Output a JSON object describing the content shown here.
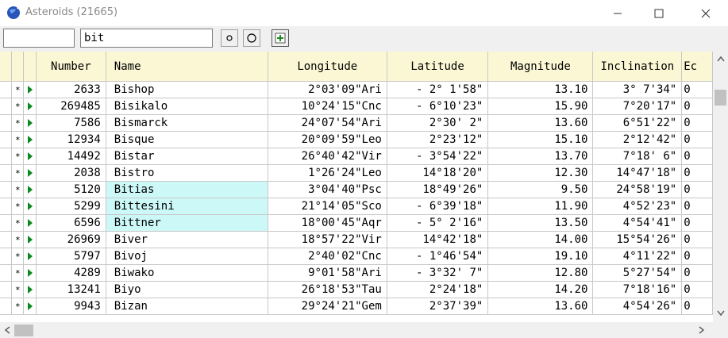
{
  "window": {
    "title": "Asteroids (21665)",
    "icon": "globe-icon"
  },
  "toolbar": {
    "field1_value": "",
    "search_value": "bit",
    "btn1_icon": "radio-small-icon",
    "btn2_icon": "radio-icon",
    "btn3_icon": "add-column-icon"
  },
  "columns": [
    "Number",
    "Name",
    "Longitude",
    "Latitude",
    "Magnitude",
    "Inclination",
    "Ec"
  ],
  "rows": [
    {
      "mark": "*",
      "number": "2633",
      "name": "Bishop",
      "longitude": "2°03'09\"Ari",
      "latitude": "- 2° 1'58\"",
      "magnitude": "13.10",
      "inclination": "3° 7'34\"",
      "ec": "0",
      "hl": false
    },
    {
      "mark": "*",
      "number": "269485",
      "name": "Bisikalo",
      "longitude": "10°24'15\"Cnc",
      "latitude": "- 6°10'23\"",
      "magnitude": "15.90",
      "inclination": "7°20'17\"",
      "ec": "0",
      "hl": false
    },
    {
      "mark": "*",
      "number": "7586",
      "name": "Bismarck",
      "longitude": "24°07'54\"Ari",
      "latitude": "2°30' 2\"",
      "magnitude": "13.60",
      "inclination": "6°51'22\"",
      "ec": "0",
      "hl": false
    },
    {
      "mark": "*",
      "number": "12934",
      "name": "Bisque",
      "longitude": "20°09'59\"Leo",
      "latitude": "2°23'12\"",
      "magnitude": "15.10",
      "inclination": "2°12'42\"",
      "ec": "0",
      "hl": false
    },
    {
      "mark": "*",
      "number": "14492",
      "name": "Bistar",
      "longitude": "26°40'42\"Vir",
      "latitude": "- 3°54'22\"",
      "magnitude": "13.70",
      "inclination": "7°18' 6\"",
      "ec": "0",
      "hl": false
    },
    {
      "mark": "*",
      "number": "2038",
      "name": "Bistro",
      "longitude": "1°26'24\"Leo",
      "latitude": "14°18'20\"",
      "magnitude": "12.30",
      "inclination": "14°47'18\"",
      "ec": "0",
      "hl": false
    },
    {
      "mark": "*",
      "number": "5120",
      "name": "Bitias",
      "longitude": "3°04'40\"Psc",
      "latitude": "18°49'26\"",
      "magnitude": "9.50",
      "inclination": "24°58'19\"",
      "ec": "0",
      "hl": true
    },
    {
      "mark": "*",
      "number": "5299",
      "name": "Bittesini",
      "longitude": "21°14'05\"Sco",
      "latitude": "- 6°39'18\"",
      "magnitude": "11.90",
      "inclination": "4°52'23\"",
      "ec": "0",
      "hl": true
    },
    {
      "mark": "*",
      "number": "6596",
      "name": "Bittner",
      "longitude": "18°00'45\"Aqr",
      "latitude": "- 5° 2'16\"",
      "magnitude": "13.50",
      "inclination": "4°54'41\"",
      "ec": "0",
      "hl": true
    },
    {
      "mark": "*",
      "number": "26969",
      "name": "Biver",
      "longitude": "18°57'22\"Vir",
      "latitude": "14°42'18\"",
      "magnitude": "14.00",
      "inclination": "15°54'26\"",
      "ec": "0",
      "hl": false
    },
    {
      "mark": "*",
      "number": "5797",
      "name": "Bivoj",
      "longitude": "2°40'02\"Cnc",
      "latitude": "- 1°46'54\"",
      "magnitude": "19.10",
      "inclination": "4°11'22\"",
      "ec": "0",
      "hl": false
    },
    {
      "mark": "*",
      "number": "4289",
      "name": "Biwako",
      "longitude": "9°01'58\"Ari",
      "latitude": "- 3°32' 7\"",
      "magnitude": "12.80",
      "inclination": "5°27'54\"",
      "ec": "0",
      "hl": false
    },
    {
      "mark": "*",
      "number": "13241",
      "name": "Biyo",
      "longitude": "26°18'53\"Tau",
      "latitude": "2°24'18\"",
      "magnitude": "14.20",
      "inclination": "7°18'16\"",
      "ec": "0",
      "hl": false
    },
    {
      "mark": "*",
      "number": "9943",
      "name": "Bizan",
      "longitude": "29°24'21\"Gem",
      "latitude": "2°37'39\"",
      "magnitude": "13.60",
      "inclination": "4°54'26\"",
      "ec": "0",
      "hl": false
    }
  ],
  "colors": {
    "header_bg": "#fbf7d4",
    "highlight": "#cdf8f8",
    "play_marker": "#0a8a1e"
  }
}
